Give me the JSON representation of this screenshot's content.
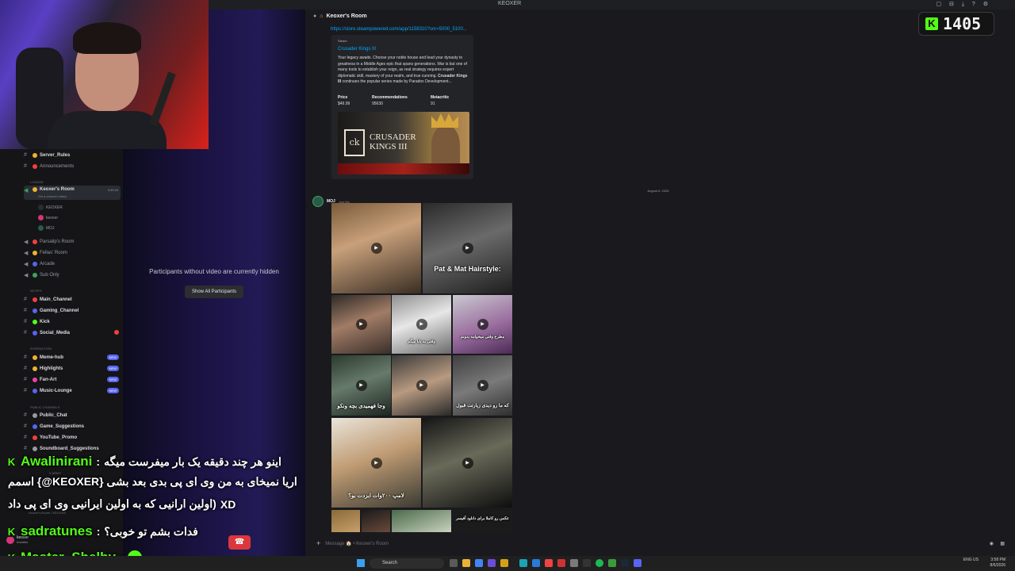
{
  "window": {
    "title": "KEOXER"
  },
  "overlay": {
    "counter_value": "1405",
    "counter_logo": "K",
    "chat": [
      {
        "user": "Awalinirani",
        "separator": ":",
        "message": "اینو هر چند دقیقه یک بار میفرست میگه"
      },
      {
        "user": "",
        "separator": "",
        "message": "اریا نمیخای به من وی ای پی بدی بعد بشی {KEOXER@} اسمم"
      },
      {
        "user": "",
        "separator": "",
        "message": "(اولین ارانیی که به اولین ایرانیی وی ای پی داد",
        "suffix": "XD"
      },
      {
        "user": "sadratunes",
        "separator": ":",
        "message": "فدات بشم تو خوبی؟"
      },
      {
        "user": "Master_Shelby",
        "separator": ":",
        "message": ""
      }
    ]
  },
  "sidebar": {
    "channels_top": [
      {
        "name": "Server_Rules",
        "color": "#f0b232"
      },
      {
        "name": "Announcements",
        "color": "#f23f43"
      }
    ],
    "cat_lounge": "Lounge",
    "voice": {
      "name": "Keoxer's Room",
      "status": "Set a channel status",
      "time": "3:49:34"
    },
    "voice_users": [
      "KEOXER",
      "keoxer",
      "MOJ"
    ],
    "voice_rooms": [
      "Parsalip's Room",
      "Fellas' Room",
      "Arcade",
      "Sub Only"
    ],
    "cat_notifs": "Notifs",
    "notif_channels": [
      {
        "name": "Main_Channel",
        "color": "#f23f43"
      },
      {
        "name": "Gaming_Channel",
        "color": "#5865f2"
      },
      {
        "name": "Kick",
        "color": "#53fc18"
      },
      {
        "name": "Social_Media",
        "color": "#5865f2"
      }
    ],
    "cat_interaction": "Interaction",
    "interaction_channels": [
      {
        "name": "Meme-hub",
        "badge": "NEW"
      },
      {
        "name": "Highlights",
        "badge": "NEW"
      },
      {
        "name": "Fan-Art",
        "badge": "NEW"
      },
      {
        "name": "Music-Lounge",
        "badge": "NEW"
      }
    ],
    "cat_public": "Public Channels",
    "public_channels": [
      "Public_Chat",
      "Game_Suggestions",
      "YouTube_Promo",
      "Soundboard_Suggestions"
    ],
    "x_army": "X Army",
    "voice_footer": "Keoxer's Room / KEOXER",
    "user": {
      "name": "keoxer",
      "status": "Invisible"
    }
  },
  "stage": {
    "hidden_message": "Participants without video are currently hidden",
    "show_all": "Show All Participants"
  },
  "chat": {
    "header": "Keoxer's Room",
    "link": "https://store.steampowered.com/app/1158310?snr=5000_5100...",
    "embed": {
      "provider": "Steam",
      "title": "Crusader Kings III",
      "desc_pre": "Your legacy awaits. Choose your noble house and lead your dynasty to greatness in a Middle Ages epic that spans generations. War is but one of many tools to establish your reign, as real strategy requires expert diplomatic skill, mastery of your realm, and true cunning.",
      "desc_bold": "Crusader Kings III",
      "desc_post": "continues the popular series made by Paradox Development...",
      "fields": [
        {
          "name": "Price",
          "value": "$49.99"
        },
        {
          "name": "Recommendations",
          "value": "95630"
        },
        {
          "name": "Metacritic",
          "value": "91"
        }
      ],
      "poster_logo": "ck",
      "poster_text": "CRUSADER KINGS III"
    },
    "date_divider": "August 6, 2026",
    "author": "MOJ",
    "author_tag": "Just Me",
    "captions": {
      "hairstyle": "Pat & Mat Hairstyle:",
      "t1": "مطرح وقتی میخوامه بدونم",
      "t2": "وقتی به بابا میگم",
      "t3": "وجا فهمیدی بچه ونکو",
      "t4": "که ما رو دیدی زیارتت قبول",
      "t5": "لامپ ۲۰۰وات ابزدت بو؟",
      "t6": "عکس رو کاملا برای دانلود آفیسر"
    },
    "placeholder": "Message 🏠 • Keoxer's Room"
  },
  "taskbar": {
    "search": "Search",
    "lang": "ENG US",
    "time": "3:58 PM",
    "date": "8/6/2026"
  }
}
